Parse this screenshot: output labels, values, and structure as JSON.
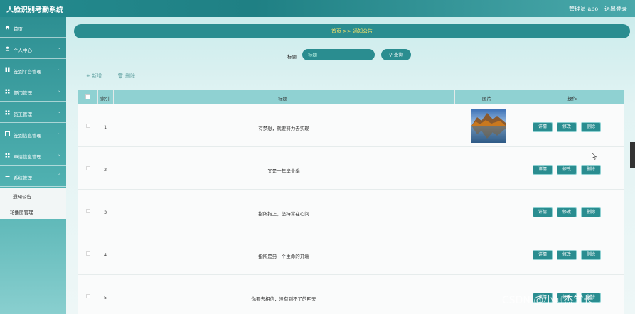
{
  "app_title": "人脸识别考勤系统",
  "header": {
    "admin_label": "管理员 abo",
    "logout_label": "退出登录"
  },
  "sidebar": {
    "items": [
      {
        "label": "首页",
        "icon": "home-icon"
      },
      {
        "label": "个人中心",
        "icon": "user-icon"
      },
      {
        "label": "签到平台管理",
        "icon": "grid-icon"
      },
      {
        "label": "部门管理",
        "icon": "grid-icon"
      },
      {
        "label": "员工管理",
        "icon": "grid-icon"
      },
      {
        "label": "签到信息管理",
        "icon": "grid-icon"
      },
      {
        "label": "申请信息管理",
        "icon": "grid-icon"
      },
      {
        "label": "系统管理",
        "icon": "menu-icon"
      }
    ],
    "submenu": [
      "通知公告",
      "轮播图管理"
    ]
  },
  "breadcrumb": {
    "home": "首页",
    "separator": ">>",
    "current": "通知公告"
  },
  "search": {
    "label": "标题",
    "placeholder": "标题",
    "button_label": "查询"
  },
  "actions": {
    "add_label": "新增",
    "delete_label": "删除"
  },
  "table": {
    "columns": [
      "索引",
      "标题",
      "图片",
      "操作"
    ],
    "row_buttons": [
      "详情",
      "修改",
      "删除"
    ],
    "rows": [
      {
        "index": "1",
        "title": "有梦想，就要努力去实现",
        "has_image": true
      },
      {
        "index": "2",
        "title": "又是一年毕业季",
        "has_image": false
      },
      {
        "index": "3",
        "title": "指所指上，坚持常在心间",
        "has_image": false
      },
      {
        "index": "4",
        "title": "指所是另一个生命的开端",
        "has_image": false
      },
      {
        "index": "5",
        "title": "你要去相信，没有到不了的明天",
        "has_image": false
      }
    ]
  },
  "watermark": "CSDN @小阿杰学长",
  "colors": {
    "accent": "#2a8d90",
    "header_bg": "#8fd1d2",
    "breadcrumb_text": "#f7e36a"
  }
}
